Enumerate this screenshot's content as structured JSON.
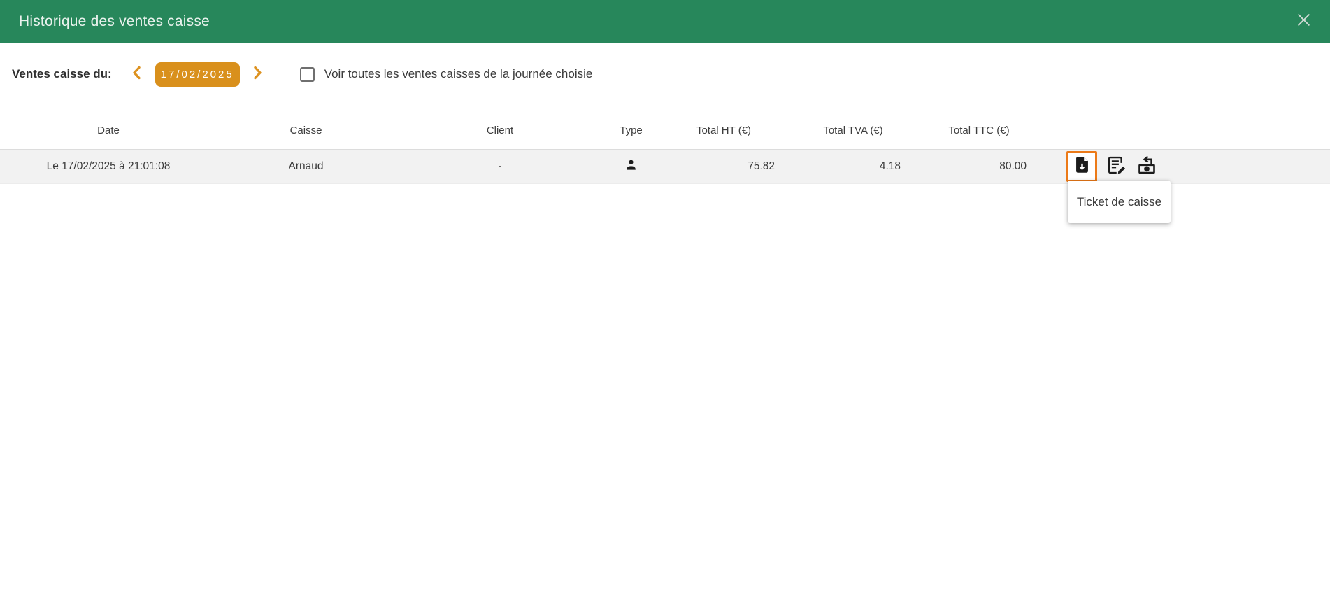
{
  "header": {
    "title": "Historique des ventes caisse",
    "close_icon": "close-icon"
  },
  "controls": {
    "label": "Ventes caisse du:",
    "prev_icon": "chevron-left-icon",
    "next_icon": "chevron-right-icon",
    "date_value": "17/02/2025",
    "checkbox_checked": false,
    "checkbox_label": "Voir toutes les ventes caisses de la journée choisie"
  },
  "table": {
    "columns": [
      "Date",
      "Caisse",
      "Client",
      "Type",
      "Total HT (€)",
      "Total TVA (€)",
      "Total TTC (€)"
    ],
    "rows": [
      {
        "date": "Le 17/02/2025 à 21:01:08",
        "caisse": "Arnaud",
        "client": "-",
        "type_icon": "person-icon",
        "total_ht": "75.82",
        "total_tva": "4.18",
        "total_ttc": "80.00",
        "actions": [
          "ticket-download-icon",
          "edit-note-icon",
          "cash-return-icon"
        ]
      }
    ]
  },
  "tooltip": {
    "text": "Ticket de caisse"
  },
  "colors": {
    "header_green": "#27875B",
    "accent_orange": "#D9901C",
    "highlight_orange": "#EC7A18",
    "row_bg": "#F2F2F2",
    "title_text": "#E9F2ED"
  }
}
